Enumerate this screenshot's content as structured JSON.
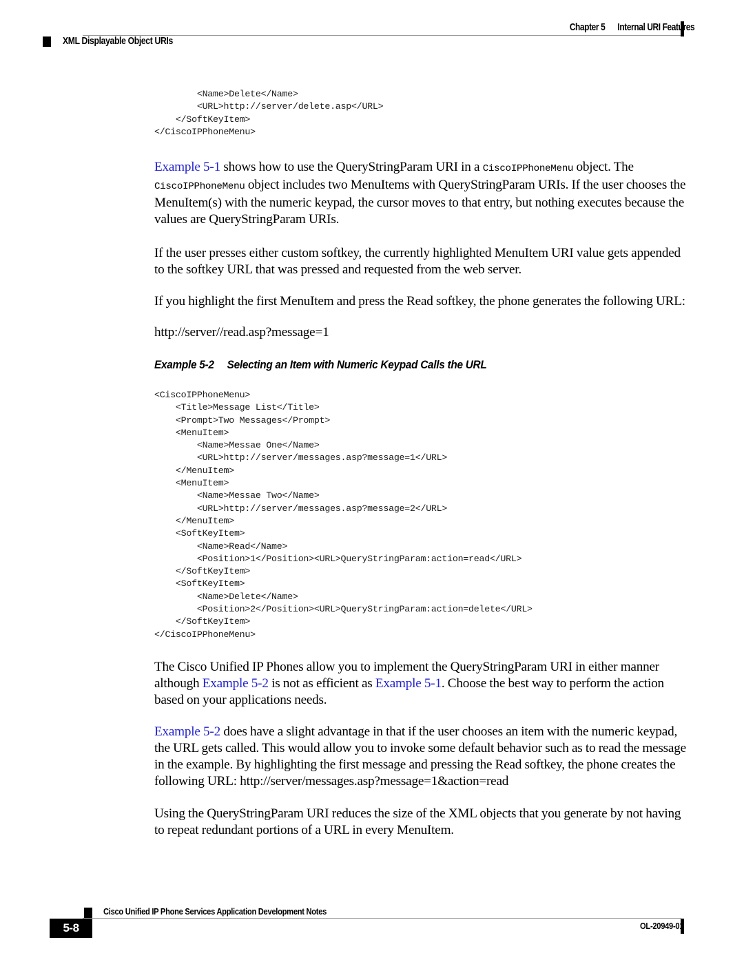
{
  "header": {
    "chapter_label": "Chapter 5",
    "chapter_title": "Internal URI Features",
    "section_title": "XML Displayable Object URIs"
  },
  "body": {
    "code_top": "        <Name>Delete</Name>\n        <URL>http://server/delete.asp</URL>\n    </SoftKeyItem>\n</CiscoIPPhoneMenu>",
    "para1": {
      "xref": "Example 5-1",
      "t1": " shows how to use the QueryStringParam URI in a ",
      "mono1": "CiscoIPPhoneMenu",
      "t2": " object. The ",
      "mono2": "CiscoIPPhoneMenu",
      "t3": " object includes two MenuItems with QueryStringParam URIs. If the user chooses the MenuItem(s) with the numeric keypad, the cursor moves to that entry, but nothing executes because the values are QueryStringParam URIs."
    },
    "para2": "If the user presses either custom softkey, the currently highlighted MenuItem URI value gets appended to the softkey URL that was pressed and requested from the web server.",
    "para3": "If you highlight the first MenuItem and press the Read softkey, the phone generates the following URL:",
    "para4": "http://server//read.asp?message=1",
    "example_caption": {
      "number": "Example 5-2",
      "title": "Selecting an Item with Numeric Keypad Calls the URL"
    },
    "code_example": "<CiscoIPPhoneMenu>\n    <Title>Message List</Title>\n    <Prompt>Two Messages</Prompt>\n    <MenuItem>\n        <Name>Messae One</Name>\n        <URL>http://server/messages.asp?message=1</URL>\n    </MenuItem>\n    <MenuItem>\n        <Name>Messae Two</Name>\n        <URL>http://server/messages.asp?message=2</URL>\n    </MenuItem>\n    <SoftKeyItem>\n        <Name>Read</Name>\n        <Position>1</Position><URL>QueryStringParam:action=read</URL>\n    </SoftKeyItem>\n    <SoftKeyItem>\n        <Name>Delete</Name>\n        <Position>2</Position><URL>QueryStringParam:action=delete</URL>\n    </SoftKeyItem>\n</CiscoIPPhoneMenu>",
    "para5": {
      "t1": "The Cisco Unified IP Phones allow you to implement the QueryStringParam URI in either manner although ",
      "xref1": "Example 5-2",
      "t2": " is not as efficient as ",
      "xref2": "Example 5-1",
      "t3": ". Choose the best way to perform the action based on your applications needs."
    },
    "para6": {
      "xref": "Example 5-2",
      "t1": " does have a slight advantage in that if the user chooses an item with the numeric keypad, the URL gets called. This would allow you to invoke some default behavior such as to read the message in the example. By highlighting the first message and pressing the Read softkey, the phone creates the following URL: http://server/messages.asp?message=1&action=read"
    },
    "para7": "Using the QueryStringParam URI reduces the size of the XML objects that you generate by not having to repeat redundant portions of a URL in every MenuItem."
  },
  "footer": {
    "page_number": "5-8",
    "doc_title": "Cisco Unified IP Phone Services Application Development Notes",
    "doc_number": "OL-20949-01"
  }
}
